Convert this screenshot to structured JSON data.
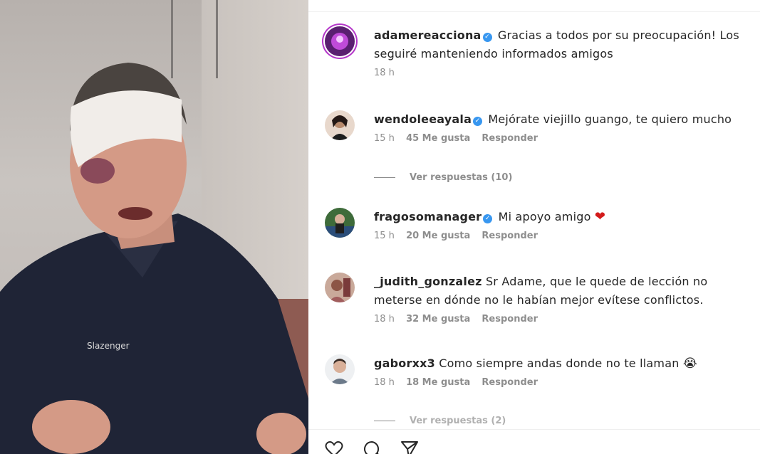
{
  "comments": [
    {
      "username": "adamereacciona",
      "verified": true,
      "text": "Gracias a todos por su preocupación! Los seguiré manteniendo informados amigos",
      "time": "18 h",
      "likes": "",
      "reply": ""
    },
    {
      "username": "wendoleeayala",
      "verified": true,
      "text": "Mejórate viejillo guango, te quiero mucho",
      "time": "15 h",
      "likes": "45 Me gusta",
      "reply": "Responder",
      "view_replies": "Ver respuestas (10)"
    },
    {
      "username": "fragosomanager",
      "verified": true,
      "text": "Mi apoyo amigo",
      "emoji": "❤",
      "time": "15 h",
      "likes": "20 Me gusta",
      "reply": "Responder"
    },
    {
      "username": "_judith_gonzalez",
      "verified": false,
      "text": "Sr Adame, que le quede de lección no meterse en dónde no le habían mejor evítese conflictos.",
      "time": "18 h",
      "likes": "32 Me gusta",
      "reply": "Responder"
    },
    {
      "username": "gaborxx3",
      "verified": false,
      "text": "Como siempre andas donde no te llaman",
      "emoji": "😭",
      "time": "18 h",
      "likes": "18 Me gusta",
      "reply": "Responder",
      "view_replies": "Ver respuestas (2)"
    }
  ],
  "icons": [
    "heart-icon",
    "comment-icon",
    "share-icon"
  ],
  "colors": {
    "verified": "#3897f0",
    "meta": "#8e8e8e",
    "heart": "#d31b1b"
  }
}
